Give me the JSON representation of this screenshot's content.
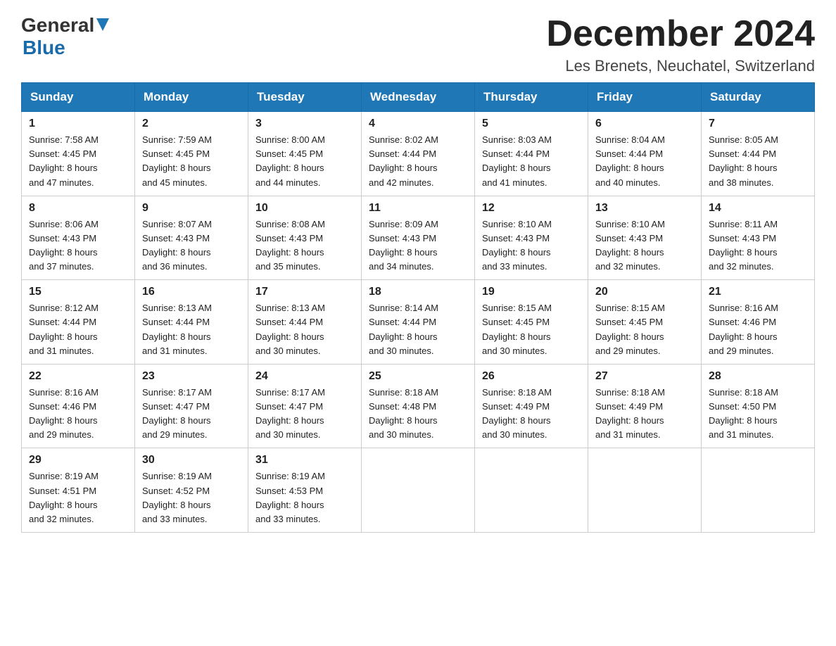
{
  "header": {
    "logo_general": "General",
    "logo_blue": "Blue",
    "month_title": "December 2024",
    "location": "Les Brenets, Neuchatel, Switzerland"
  },
  "weekdays": [
    "Sunday",
    "Monday",
    "Tuesday",
    "Wednesday",
    "Thursday",
    "Friday",
    "Saturday"
  ],
  "weeks": [
    [
      {
        "day": "1",
        "sunrise": "7:58 AM",
        "sunset": "4:45 PM",
        "daylight": "8 hours and 47 minutes."
      },
      {
        "day": "2",
        "sunrise": "7:59 AM",
        "sunset": "4:45 PM",
        "daylight": "8 hours and 45 minutes."
      },
      {
        "day": "3",
        "sunrise": "8:00 AM",
        "sunset": "4:45 PM",
        "daylight": "8 hours and 44 minutes."
      },
      {
        "day": "4",
        "sunrise": "8:02 AM",
        "sunset": "4:44 PM",
        "daylight": "8 hours and 42 minutes."
      },
      {
        "day": "5",
        "sunrise": "8:03 AM",
        "sunset": "4:44 PM",
        "daylight": "8 hours and 41 minutes."
      },
      {
        "day": "6",
        "sunrise": "8:04 AM",
        "sunset": "4:44 PM",
        "daylight": "8 hours and 40 minutes."
      },
      {
        "day": "7",
        "sunrise": "8:05 AM",
        "sunset": "4:44 PM",
        "daylight": "8 hours and 38 minutes."
      }
    ],
    [
      {
        "day": "8",
        "sunrise": "8:06 AM",
        "sunset": "4:43 PM",
        "daylight": "8 hours and 37 minutes."
      },
      {
        "day": "9",
        "sunrise": "8:07 AM",
        "sunset": "4:43 PM",
        "daylight": "8 hours and 36 minutes."
      },
      {
        "day": "10",
        "sunrise": "8:08 AM",
        "sunset": "4:43 PM",
        "daylight": "8 hours and 35 minutes."
      },
      {
        "day": "11",
        "sunrise": "8:09 AM",
        "sunset": "4:43 PM",
        "daylight": "8 hours and 34 minutes."
      },
      {
        "day": "12",
        "sunrise": "8:10 AM",
        "sunset": "4:43 PM",
        "daylight": "8 hours and 33 minutes."
      },
      {
        "day": "13",
        "sunrise": "8:10 AM",
        "sunset": "4:43 PM",
        "daylight": "8 hours and 32 minutes."
      },
      {
        "day": "14",
        "sunrise": "8:11 AM",
        "sunset": "4:43 PM",
        "daylight": "8 hours and 32 minutes."
      }
    ],
    [
      {
        "day": "15",
        "sunrise": "8:12 AM",
        "sunset": "4:44 PM",
        "daylight": "8 hours and 31 minutes."
      },
      {
        "day": "16",
        "sunrise": "8:13 AM",
        "sunset": "4:44 PM",
        "daylight": "8 hours and 31 minutes."
      },
      {
        "day": "17",
        "sunrise": "8:13 AM",
        "sunset": "4:44 PM",
        "daylight": "8 hours and 30 minutes."
      },
      {
        "day": "18",
        "sunrise": "8:14 AM",
        "sunset": "4:44 PM",
        "daylight": "8 hours and 30 minutes."
      },
      {
        "day": "19",
        "sunrise": "8:15 AM",
        "sunset": "4:45 PM",
        "daylight": "8 hours and 30 minutes."
      },
      {
        "day": "20",
        "sunrise": "8:15 AM",
        "sunset": "4:45 PM",
        "daylight": "8 hours and 29 minutes."
      },
      {
        "day": "21",
        "sunrise": "8:16 AM",
        "sunset": "4:46 PM",
        "daylight": "8 hours and 29 minutes."
      }
    ],
    [
      {
        "day": "22",
        "sunrise": "8:16 AM",
        "sunset": "4:46 PM",
        "daylight": "8 hours and 29 minutes."
      },
      {
        "day": "23",
        "sunrise": "8:17 AM",
        "sunset": "4:47 PM",
        "daylight": "8 hours and 29 minutes."
      },
      {
        "day": "24",
        "sunrise": "8:17 AM",
        "sunset": "4:47 PM",
        "daylight": "8 hours and 30 minutes."
      },
      {
        "day": "25",
        "sunrise": "8:18 AM",
        "sunset": "4:48 PM",
        "daylight": "8 hours and 30 minutes."
      },
      {
        "day": "26",
        "sunrise": "8:18 AM",
        "sunset": "4:49 PM",
        "daylight": "8 hours and 30 minutes."
      },
      {
        "day": "27",
        "sunrise": "8:18 AM",
        "sunset": "4:49 PM",
        "daylight": "8 hours and 31 minutes."
      },
      {
        "day": "28",
        "sunrise": "8:18 AM",
        "sunset": "4:50 PM",
        "daylight": "8 hours and 31 minutes."
      }
    ],
    [
      {
        "day": "29",
        "sunrise": "8:19 AM",
        "sunset": "4:51 PM",
        "daylight": "8 hours and 32 minutes."
      },
      {
        "day": "30",
        "sunrise": "8:19 AM",
        "sunset": "4:52 PM",
        "daylight": "8 hours and 33 minutes."
      },
      {
        "day": "31",
        "sunrise": "8:19 AM",
        "sunset": "4:53 PM",
        "daylight": "8 hours and 33 minutes."
      },
      null,
      null,
      null,
      null
    ]
  ],
  "labels": {
    "sunrise": "Sunrise:",
    "sunset": "Sunset:",
    "daylight": "Daylight:"
  }
}
